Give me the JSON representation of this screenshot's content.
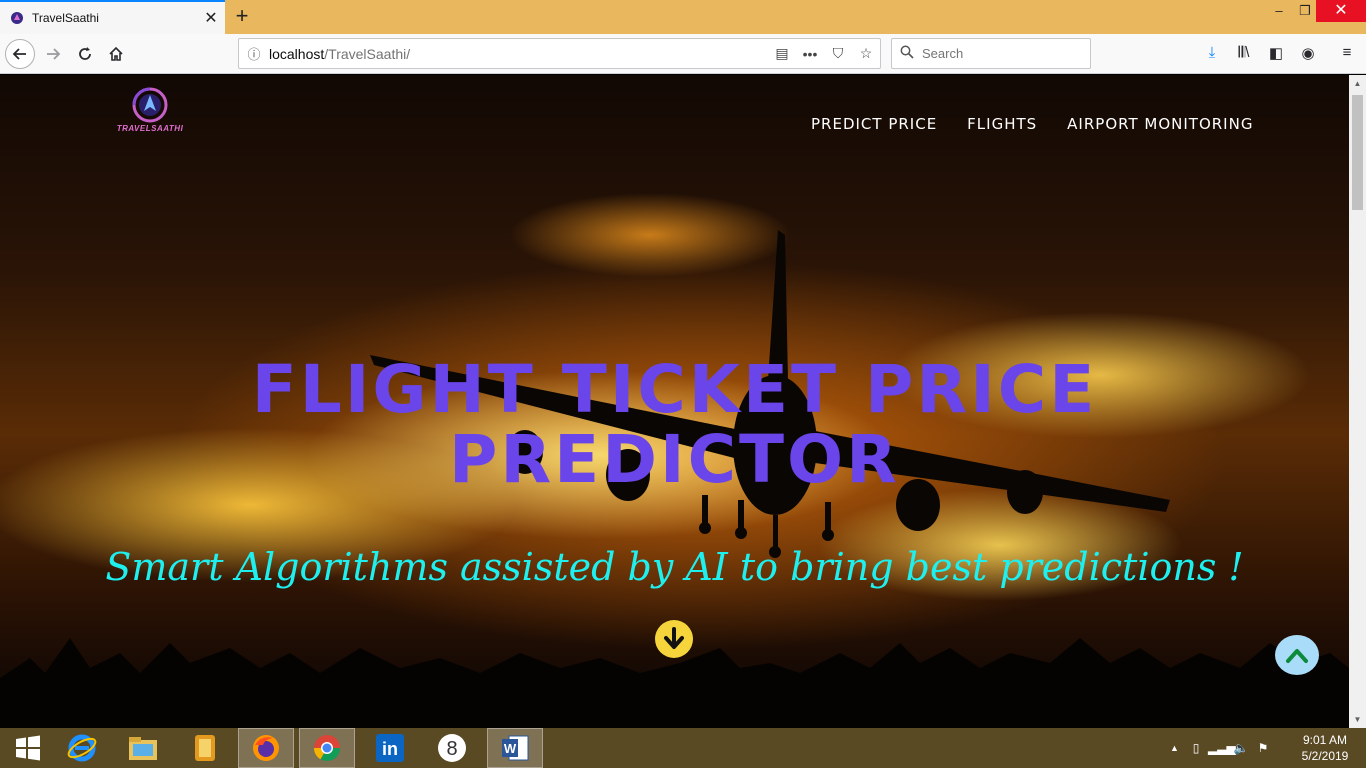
{
  "browser": {
    "tab_title": "TravelSaathi",
    "url_host": "localhost",
    "url_path": "/TravelSaathi/",
    "search_placeholder": "Search",
    "accent": "#0a84ff"
  },
  "site": {
    "logo_text": "TRAVELSAATHI",
    "menu": [
      "PREDICT PRICE",
      "FLIGHTS",
      "AIRPORT MONITORING"
    ],
    "hero_title_line1": "FLIGHT TICKET PRICE",
    "hero_title_line2": "PREDICTOR",
    "hero_subtitle": "Smart Algorithms assisted by AI to bring best predictions !",
    "title_color": "#6a45e9",
    "subtitle_color": "#1ef0f0",
    "scroll_down_color": "#f6d53c",
    "back_to_top_color": "#a9dcf8"
  },
  "taskbar": {
    "apps": [
      "windows-start",
      "internet-explorer",
      "file-explorer",
      "file-manager",
      "firefox",
      "chrome",
      "linkedin",
      "app-8",
      "word"
    ],
    "active_app": "firefox",
    "time": "9:01 AM",
    "date": "5/2/2019"
  }
}
